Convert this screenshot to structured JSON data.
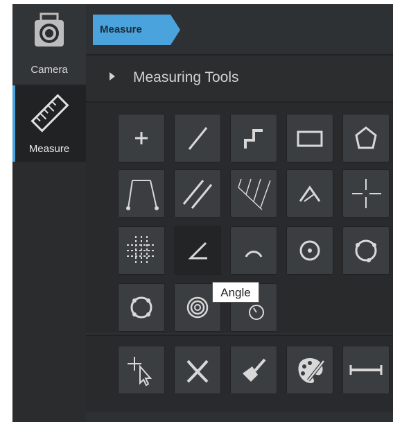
{
  "sidebar": {
    "items": [
      {
        "label": "Camera",
        "icon": "camera-icon"
      },
      {
        "label": "Measure",
        "icon": "ruler-icon",
        "active": true
      }
    ]
  },
  "breadcrumb": {
    "label": "Measure"
  },
  "section": {
    "title": "Measuring Tools",
    "icon": "expand-arrow-icon"
  },
  "tools": {
    "rows": [
      [
        "point-tool-icon",
        "line-tool-icon",
        "polyline-tool-icon",
        "rectangle-tool-icon",
        "polygon-tool-icon"
      ],
      [
        "two-line-distance-icon",
        "parallel-lines-icon",
        "multi-line-icon",
        "angle-tool-icon",
        "crosshair-tool-icon"
      ],
      [
        "grid-tool-icon",
        "angle-icon",
        "arc-tool-icon",
        "circle-center-icon",
        "three-point-circle-icon"
      ],
      [
        "four-point-circle-icon",
        "concentric-circles-icon",
        "circle-radius-icon"
      ]
    ],
    "bottom": [
      "select-pointer-icon",
      "delete-icon",
      "clear-brush-icon",
      "color-palette-icon",
      "ruler-scale-icon"
    ]
  },
  "tooltip": {
    "text": "Angle"
  },
  "colors": {
    "accent": "#4aa3dd",
    "panel": "#2e3133",
    "button": "#3b3e41"
  }
}
